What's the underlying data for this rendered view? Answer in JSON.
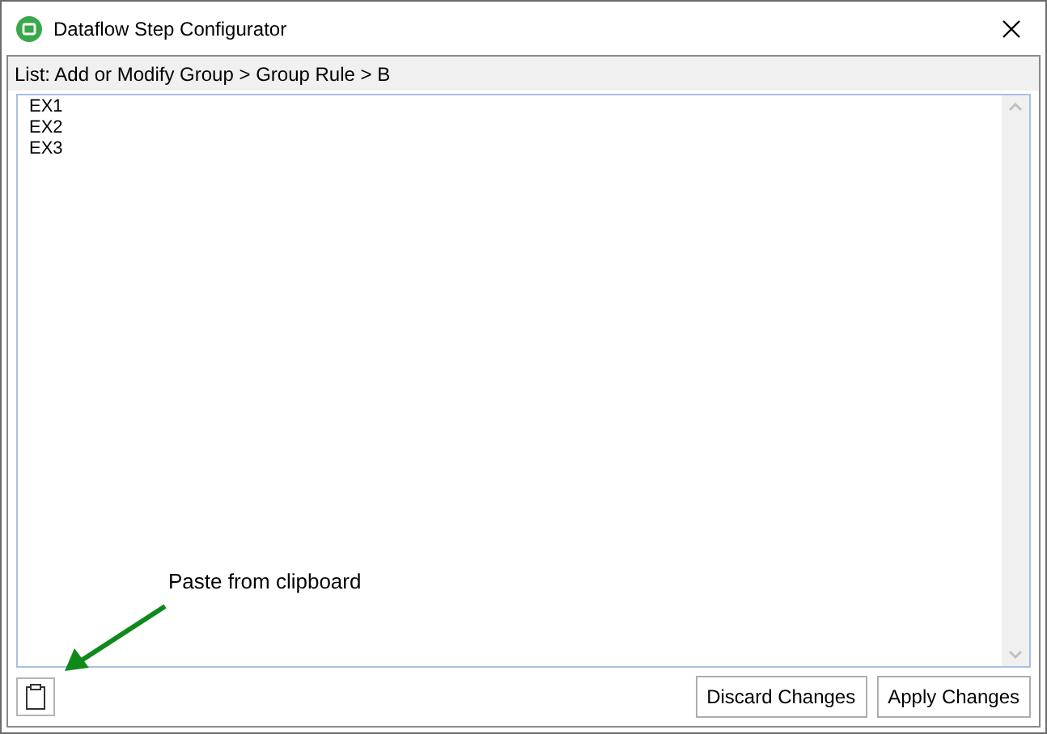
{
  "window": {
    "title": "Dataflow Step Configurator"
  },
  "header": "List: Add or Modify Group > Group Rule > B",
  "list_editor": {
    "lines": [
      "EX1",
      "EX2",
      "EX3"
    ]
  },
  "annotation": "Paste from clipboard",
  "buttons": [
    "Discard Changes",
    "Apply Changes"
  ]
}
